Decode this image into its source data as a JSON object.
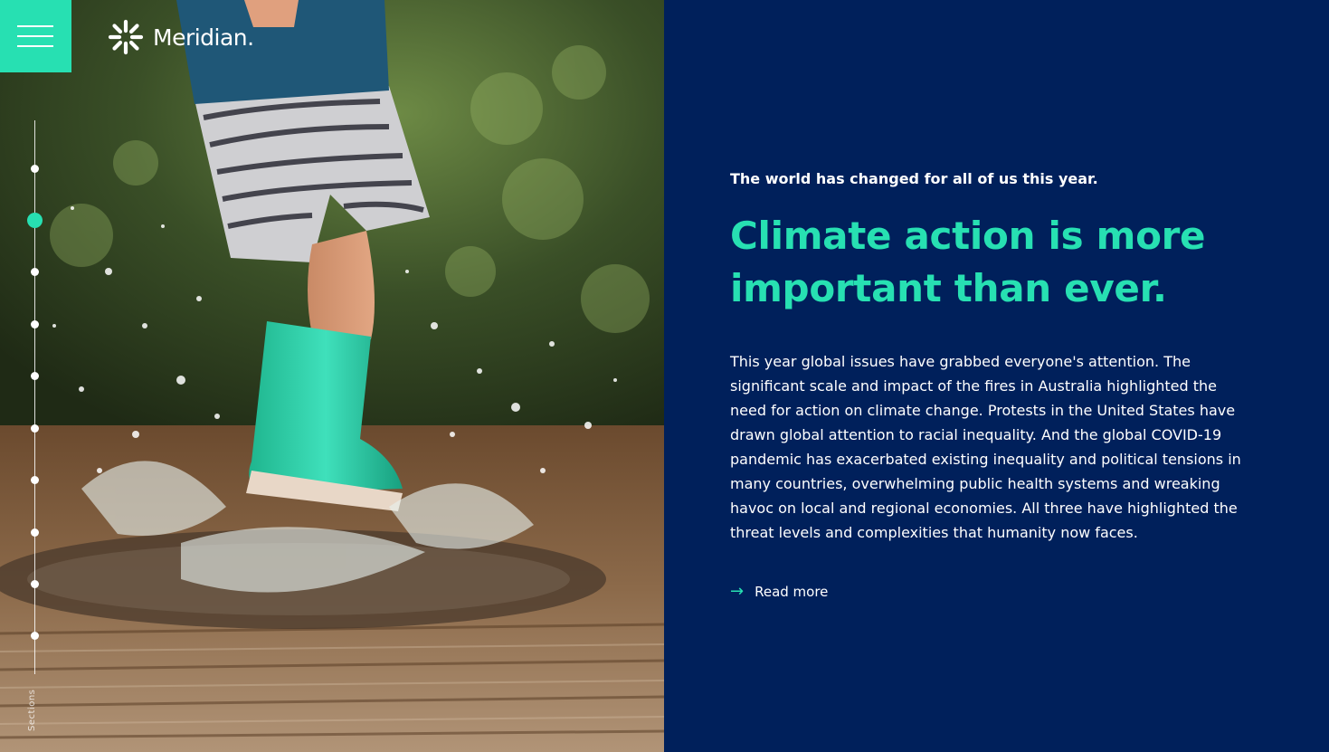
{
  "colors": {
    "accent": "#27e0b2",
    "background": "#00205b",
    "text": "#ffffff"
  },
  "header": {
    "menu_icon": "hamburger-icon",
    "logo_text": "Meridian.",
    "logo_icon": "starburst-logo-icon"
  },
  "hero_image": {
    "icon": "photo-child-in-green-rain-boots-splashing-puddle"
  },
  "section_nav": {
    "label": "Sections",
    "dot_count": 10,
    "active_index": 1
  },
  "main": {
    "eyebrow": "The world has changed for all of us this year.",
    "headline": "Climate action is more important than ever.",
    "body": "This year global issues have grabbed everyone's attention. The significant scale and impact of the fires in Australia highlighted the need for action on climate change. Protests in the United States have drawn global attention to racial inequality. And the global COVID-19 pandemic has exacerbated existing inequality and political tensions in many countries, overwhelming public health systems and wreaking havoc on local and regional economies. All three have highlighted the threat levels and complexities that humanity now faces.",
    "read_more": {
      "label": "Read more",
      "icon": "arrow-right-icon"
    }
  }
}
